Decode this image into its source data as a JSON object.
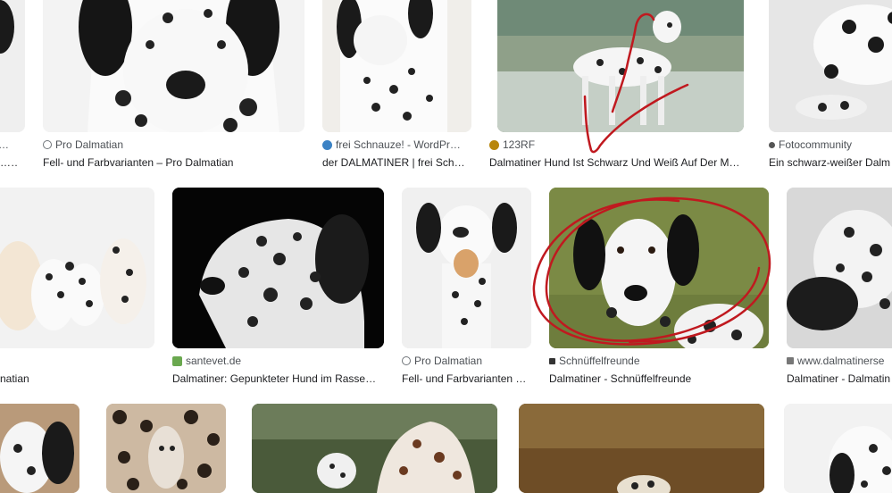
{
  "results": [
    {
      "source": "…",
      "title": "…ma…"
    },
    {
      "source": "Pro Dalmatian",
      "title": "Fell- und Farbvarianten – Pro Dalmatian"
    },
    {
      "source": "frei Schnauze! - WordPr…",
      "title": "der DALMATINER | frei Sch…"
    },
    {
      "source": "123RF",
      "title": "Dalmatiner Hund Ist Schwarz Und Weiß Auf Der M…"
    },
    {
      "source": "Fotocommunity",
      "title": "Ein schwarz-weißer Dalm"
    },
    {
      "source": "",
      "title": "natian"
    },
    {
      "source": "santevet.de",
      "title": "Dalmatiner: Gepunkteter Hund im Rasse…"
    },
    {
      "source": "Pro Dalmatian",
      "title": "Fell- und Farbvarianten …"
    },
    {
      "source": "Schnüffelfreunde",
      "title": "Dalmatiner - Schnüffelfreunde"
    },
    {
      "source": "www.dalmatinerse",
      "title": "Dalmatiner - Dalmatin"
    }
  ],
  "colors": {
    "source_text": "#4d5156",
    "title_text": "#202124",
    "annotation_ink": "#c0191f"
  }
}
